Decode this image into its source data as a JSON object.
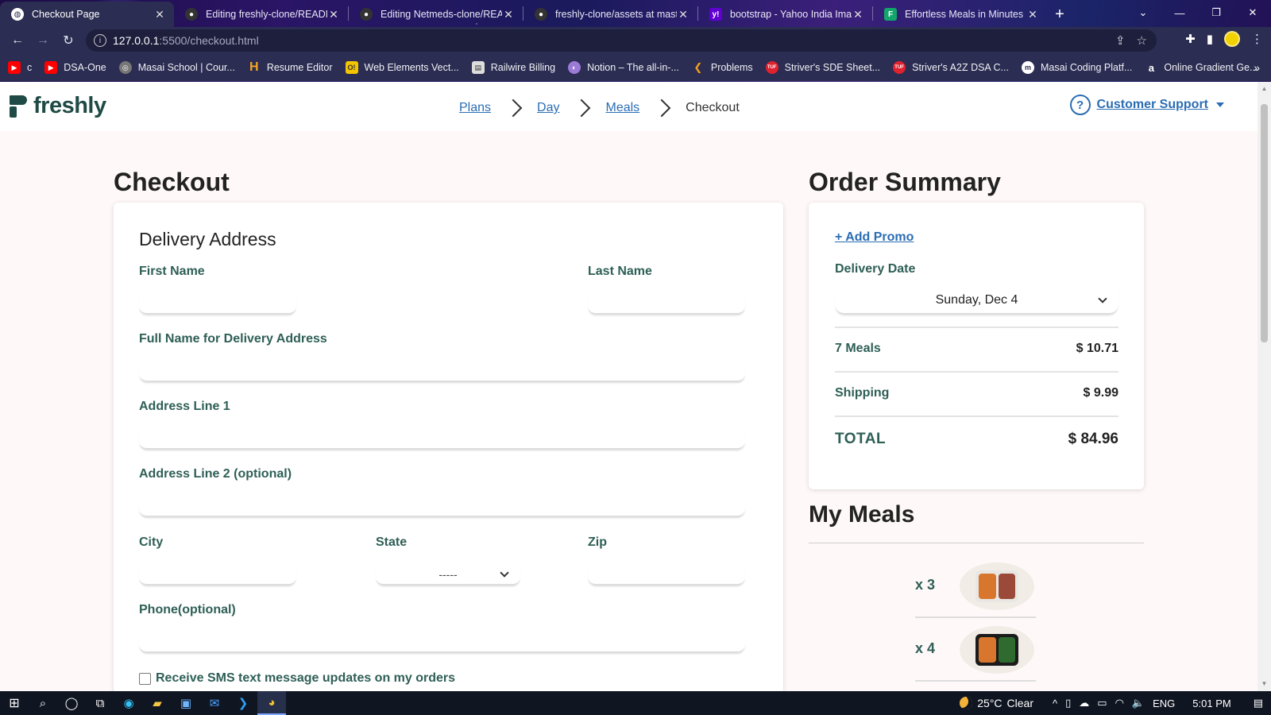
{
  "browser": {
    "tabs": [
      {
        "title": "Checkout Page",
        "active": true,
        "icon": "globe-icon",
        "color": "#ffffff"
      },
      {
        "title": "Editing freshly-clone/README",
        "active": false,
        "icon": "github-icon",
        "color": "#333333"
      },
      {
        "title": "Editing Netmeds-clone/READ",
        "active": false,
        "icon": "github-icon",
        "color": "#333333"
      },
      {
        "title": "freshly-clone/assets at maste",
        "active": false,
        "icon": "github-icon",
        "color": "#333333"
      },
      {
        "title": "bootstrap - Yahoo India Imag",
        "active": false,
        "icon": "yahoo-icon",
        "color": "#6001d2"
      },
      {
        "title": "Effortless Meals in Minutes",
        "active": false,
        "icon": "freshly-icon",
        "color": "#12a66b"
      }
    ],
    "url_host": "127.0.0.1",
    "url_path": ":5500/checkout.html",
    "bookmarks": [
      {
        "label": "c",
        "icon": "youtube-icon",
        "color": "#ff0000"
      },
      {
        "label": "DSA-One",
        "icon": "youtube-icon",
        "color": "#ff0000"
      },
      {
        "label": "Masai School | Cour...",
        "icon": "masai-icon",
        "color": "#888888"
      },
      {
        "label": "Resume Editor",
        "icon": "h-icon",
        "color": "#f5a623"
      },
      {
        "label": "Web Elements Vect...",
        "icon": "o-icon",
        "color": "#f5c400"
      },
      {
        "label": "Railwire Billing",
        "icon": "document-icon",
        "color": "#dddddd"
      },
      {
        "label": "Notion – The all-in-...",
        "icon": "notion-icon",
        "color": "#9b7bd6"
      },
      {
        "label": "Problems",
        "icon": "leetcode-icon",
        "color": "#f89f1b"
      },
      {
        "label": "Striver's SDE Sheet...",
        "icon": "tuf-icon",
        "color": "#e0212e"
      },
      {
        "label": "Striver's A2Z DSA C...",
        "icon": "tuf-icon",
        "color": "#e0212e"
      },
      {
        "label": "Masai Coding Platf...",
        "icon": "m-icon",
        "color": "#ffffff"
      },
      {
        "label": "Online Gradient Ge...",
        "icon": "a-icon",
        "color": "#2b2d52"
      }
    ]
  },
  "site": {
    "logo": "freshly",
    "breadcrumb": [
      {
        "label": "Plans",
        "link": true
      },
      {
        "label": "Day",
        "link": true
      },
      {
        "label": "Meals",
        "link": true
      },
      {
        "label": "Checkout",
        "link": false
      }
    ],
    "support_label": "Customer Support",
    "support_icon": "?"
  },
  "checkout": {
    "heading": "Checkout",
    "card_title": "Delivery Address",
    "fields": {
      "first_name": "First Name",
      "last_name": "Last Name",
      "full_name": "Full Name for Delivery Address",
      "address1": "Address Line 1",
      "address2": "Address Line 2 (optional)",
      "city": "City",
      "state": "State",
      "state_value": "-----",
      "zip": "Zip",
      "phone": "Phone(optional)"
    },
    "sms_label": "Receive SMS text message updates on my orders"
  },
  "summary": {
    "heading": "Order Summary",
    "promo": "+  Add Promo",
    "delivery_label": "Delivery Date",
    "delivery_value": "Sunday, Dec 4",
    "rows": [
      {
        "label": "7 Meals",
        "value": "$ 10.71"
      },
      {
        "label": "Shipping",
        "value": "$ 9.99"
      }
    ],
    "total_label": "TOTAL",
    "total_value": "$ 84.96"
  },
  "meals": {
    "heading": "My Meals",
    "items": [
      {
        "qty": "x 3",
        "colors": [
          "#d9762e",
          "#9b4a3a"
        ],
        "tray": "#e9e7e3"
      },
      {
        "qty": "x 4",
        "colors": [
          "#d9762e",
          "#2f6a2e"
        ],
        "tray": "#1b1b1b"
      }
    ]
  },
  "taskbar": {
    "weather_temp": "25°C",
    "weather_desc": "Clear",
    "lang": "ENG",
    "time": "5:01 PM"
  },
  "colors": {
    "brand": "#1f4a45",
    "link": "#2a6db3",
    "label": "#2e5f56",
    "page_bg": "#fff8f8"
  }
}
